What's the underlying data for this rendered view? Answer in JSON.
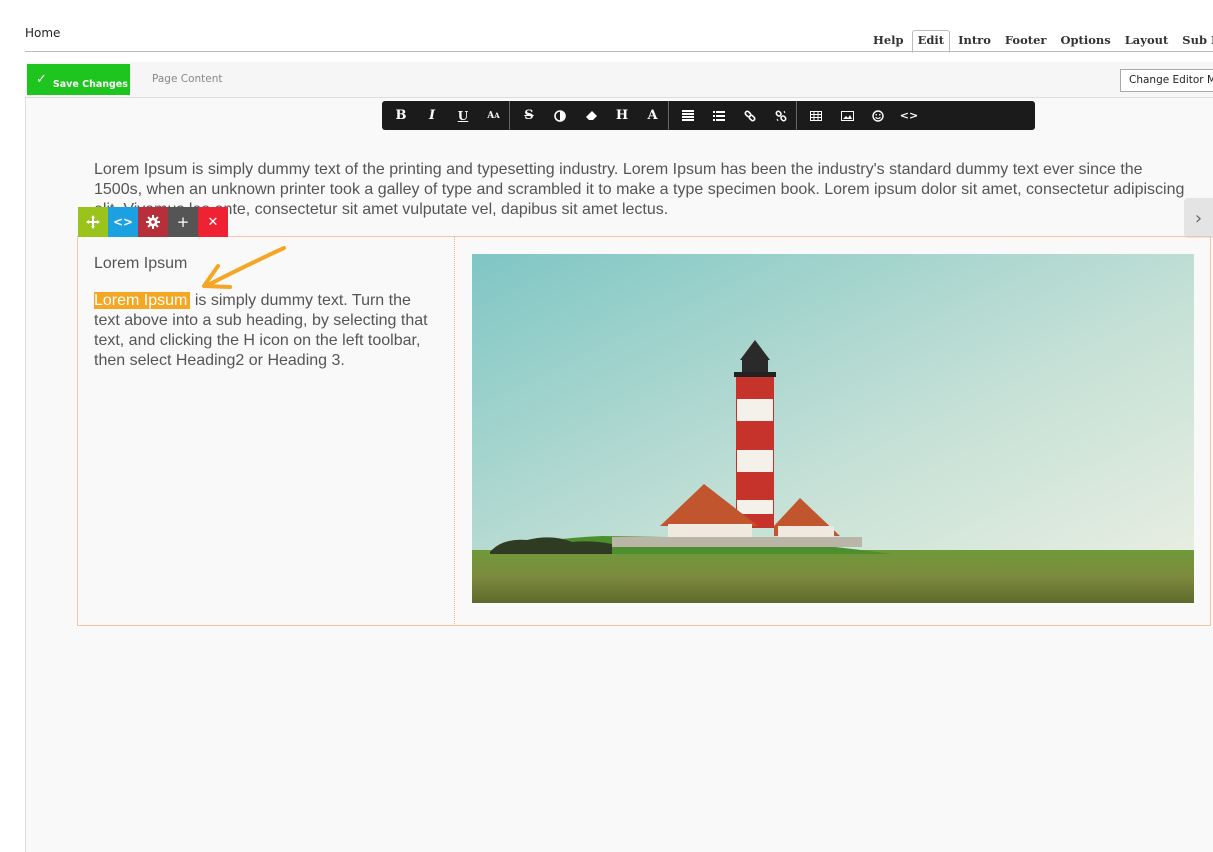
{
  "breadcrumb": "Home",
  "tabs": [
    {
      "label": "Help"
    },
    {
      "label": "Edit",
      "active": true
    },
    {
      "label": "Intro"
    },
    {
      "label": "Footer"
    },
    {
      "label": "Options"
    },
    {
      "label": "Layout"
    },
    {
      "label": "Sub Me"
    }
  ],
  "actionbar": {
    "save_label": "Save Changes",
    "page_content_label": "Page Content",
    "editor_mode_label": "Change Editor Mo"
  },
  "toolbar": {
    "buttons": [
      "bold-icon",
      "italic-icon",
      "underline-icon",
      "font-size-icon",
      "strikethrough-icon",
      "contrast-icon",
      "eraser-icon",
      "heading-icon",
      "font-color-icon",
      "paragraph-icon",
      "list-icon",
      "link-icon",
      "unlink-icon",
      "table-icon",
      "image-icon",
      "emoji-icon",
      "code-icon"
    ]
  },
  "content": {
    "intro_text": "Lorem Ipsum is simply dummy text of the printing and typesetting industry. Lorem Ipsum has been the industry's standard dummy text ever since the 1500s, when an unknown printer took a galley of type and scrambled it to make a type specimen book. Lorem ipsum dolor sit amet, consectetur adipiscing elit. Vivamus leo ante, consectetur sit amet vulputate vel, dapibus sit amet lectus.",
    "column_heading": "Lorem Ipsum",
    "highlighted": "Lorem Ipsum",
    "column_body": " is simply dummy text. Turn the text above into a sub heading, by selecting that text, and clicking the H icon on the left toolbar, then select Heading2 or Heading 3."
  },
  "row_tools": {
    "colors": {
      "move": "#9ac31c",
      "code": "#1ba1e2",
      "settings": "#b5303a",
      "add": "#555555",
      "remove": "#ee2233"
    }
  },
  "colors": {
    "save": "#1ec51e",
    "highlight": "#f5a623",
    "annotation": "#f5a623"
  }
}
